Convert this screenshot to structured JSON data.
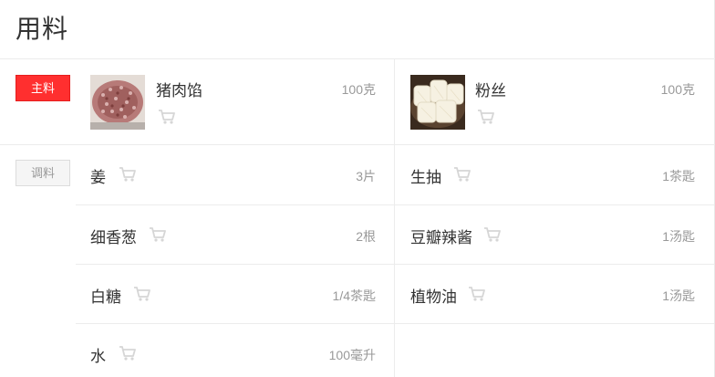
{
  "page": {
    "title": "用料"
  },
  "main_ingredients": {
    "tag": "主料",
    "items": [
      {
        "name": "猪肉馅",
        "amount": "100克",
        "image": "minced-pork"
      },
      {
        "name": "粉丝",
        "amount": "100克",
        "image": "vermicelli"
      }
    ]
  },
  "seasonings": {
    "tag": "调料",
    "items": [
      {
        "name": "姜",
        "amount": "3片"
      },
      {
        "name": "生抽",
        "amount": "1茶匙"
      },
      {
        "name": "细香葱",
        "amount": "2根"
      },
      {
        "name": "豆瓣辣酱",
        "amount": "1汤匙"
      },
      {
        "name": "白糖",
        "amount": "1/4茶匙"
      },
      {
        "name": "植物油",
        "amount": "1汤匙"
      },
      {
        "name": "水",
        "amount": "100毫升"
      }
    ]
  },
  "icons": {
    "cart": "shopping-cart-icon"
  },
  "colors": {
    "accent": "#ff2f2f",
    "text": "#333333",
    "muted": "#999999",
    "cart": "#d6d6d6",
    "divider": "#ececec"
  }
}
